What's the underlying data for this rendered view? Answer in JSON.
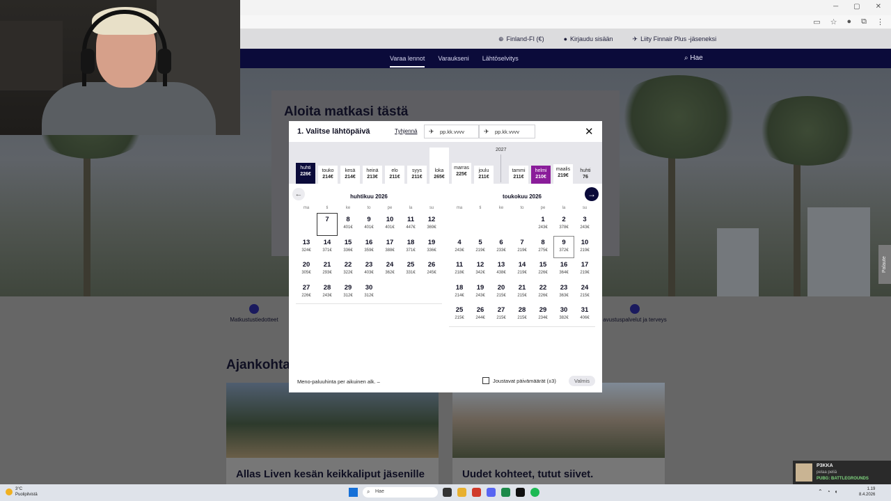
{
  "site": {
    "top_links": [
      "Finland-FI (€)",
      "Kirjaudu sisään",
      "Liity Finnair Plus -jäseneksi"
    ],
    "nav": [
      "Varaa lennot",
      "Varaukseni",
      "Lähtöselvitys"
    ],
    "search": "Hae",
    "hero_title": "Aloita matkasi tästä",
    "service_left": "Matkustustiedotteet",
    "service_right": "avustuspalvelut ja terveys",
    "section_title": "Ajankohta",
    "card_left_title": "Allas Liven kesän keikkaliput jäsenille",
    "card_right_title": "Uudet kohteet, tutut siivet.",
    "feedback": "Palaute"
  },
  "modal": {
    "title": "1. Valitse lähtöpäivä",
    "clear": "Tyhjennä",
    "date_placeholder_depart": "pp.kk.vvvv",
    "date_placeholder_return": "pp.kk.vvvv",
    "year_label": "2027",
    "months": [
      {
        "name": "huhti",
        "price": "226€"
      },
      {
        "name": "touko",
        "price": "214€"
      },
      {
        "name": "kesä",
        "price": "214€"
      },
      {
        "name": "heinä",
        "price": "213€"
      },
      {
        "name": "elo",
        "price": "211€"
      },
      {
        "name": "syys",
        "price": "211€"
      },
      {
        "name": "loka",
        "price": "265€"
      },
      {
        "name": "marras",
        "price": "225€"
      },
      {
        "name": "joulu",
        "price": "211€"
      },
      {
        "name": "tammi",
        "price": "211€"
      },
      {
        "name": "helmi",
        "price": "210€"
      },
      {
        "name": "maalis",
        "price": "219€"
      },
      {
        "name": "huhti",
        "price": "76"
      }
    ],
    "weekdays": [
      "ma",
      "ti",
      "ke",
      "to",
      "pe",
      "la",
      "su"
    ],
    "left_title": "huhtikuu 2026",
    "right_title": "toukokuu 2026",
    "left_days": [
      {
        "d": "",
        "p": ""
      },
      {
        "d": "7",
        "p": ""
      },
      {
        "d": "8",
        "p": "401€"
      },
      {
        "d": "9",
        "p": "401€"
      },
      {
        "d": "10",
        "p": "401€"
      },
      {
        "d": "11",
        "p": "447€"
      },
      {
        "d": "12",
        "p": "369€"
      },
      {
        "d": "13",
        "p": "324€"
      },
      {
        "d": "14",
        "p": "371€"
      },
      {
        "d": "15",
        "p": "336€"
      },
      {
        "d": "16",
        "p": "359€"
      },
      {
        "d": "17",
        "p": "388€"
      },
      {
        "d": "18",
        "p": "371€"
      },
      {
        "d": "19",
        "p": "336€"
      },
      {
        "d": "20",
        "p": "305€"
      },
      {
        "d": "21",
        "p": "293€"
      },
      {
        "d": "22",
        "p": "322€"
      },
      {
        "d": "23",
        "p": "403€"
      },
      {
        "d": "24",
        "p": "362€"
      },
      {
        "d": "25",
        "p": "331€"
      },
      {
        "d": "26",
        "p": "245€"
      },
      {
        "d": "27",
        "p": "226€"
      },
      {
        "d": "28",
        "p": "243€"
      },
      {
        "d": "29",
        "p": "312€"
      },
      {
        "d": "30",
        "p": "312€"
      }
    ],
    "right_days": [
      {
        "d": "",
        "p": ""
      },
      {
        "d": "",
        "p": ""
      },
      {
        "d": "",
        "p": ""
      },
      {
        "d": "",
        "p": ""
      },
      {
        "d": "1",
        "p": "243€"
      },
      {
        "d": "2",
        "p": "378€"
      },
      {
        "d": "3",
        "p": "243€"
      },
      {
        "d": "4",
        "p": "243€"
      },
      {
        "d": "5",
        "p": "219€"
      },
      {
        "d": "6",
        "p": "233€"
      },
      {
        "d": "7",
        "p": "219€"
      },
      {
        "d": "8",
        "p": "275€"
      },
      {
        "d": "9",
        "p": "372€"
      },
      {
        "d": "10",
        "p": "219€"
      },
      {
        "d": "11",
        "p": "218€"
      },
      {
        "d": "12",
        "p": "342€"
      },
      {
        "d": "13",
        "p": "438€"
      },
      {
        "d": "14",
        "p": "219€"
      },
      {
        "d": "15",
        "p": "226€"
      },
      {
        "d": "16",
        "p": "364€"
      },
      {
        "d": "17",
        "p": "219€"
      },
      {
        "d": "18",
        "p": "214€"
      },
      {
        "d": "19",
        "p": "243€"
      },
      {
        "d": "20",
        "p": "215€"
      },
      {
        "d": "21",
        "p": "215€"
      },
      {
        "d": "22",
        "p": "226€"
      },
      {
        "d": "23",
        "p": "363€"
      },
      {
        "d": "24",
        "p": "215€"
      },
      {
        "d": "25",
        "p": "215€"
      },
      {
        "d": "26",
        "p": "244€"
      },
      {
        "d": "27",
        "p": "215€"
      },
      {
        "d": "28",
        "p": "215€"
      },
      {
        "d": "29",
        "p": "234€"
      },
      {
        "d": "30",
        "p": "382€"
      },
      {
        "d": "31",
        "p": "406€"
      }
    ],
    "footer_note": "Meno-paluuhinta per aikuinen alk. –",
    "flexible": "Joustavat päivämäärät (±3)",
    "done": "Valmis"
  },
  "stream": {
    "name": "P3KKA",
    "status": "pelaa peliä",
    "game": "PUBG: BATTLEGROUNDS"
  },
  "taskbar": {
    "temp": "3°C",
    "weather": "Puolipilvistä",
    "search": "Hae",
    "time": "1.19",
    "date": "8.4.2026"
  }
}
